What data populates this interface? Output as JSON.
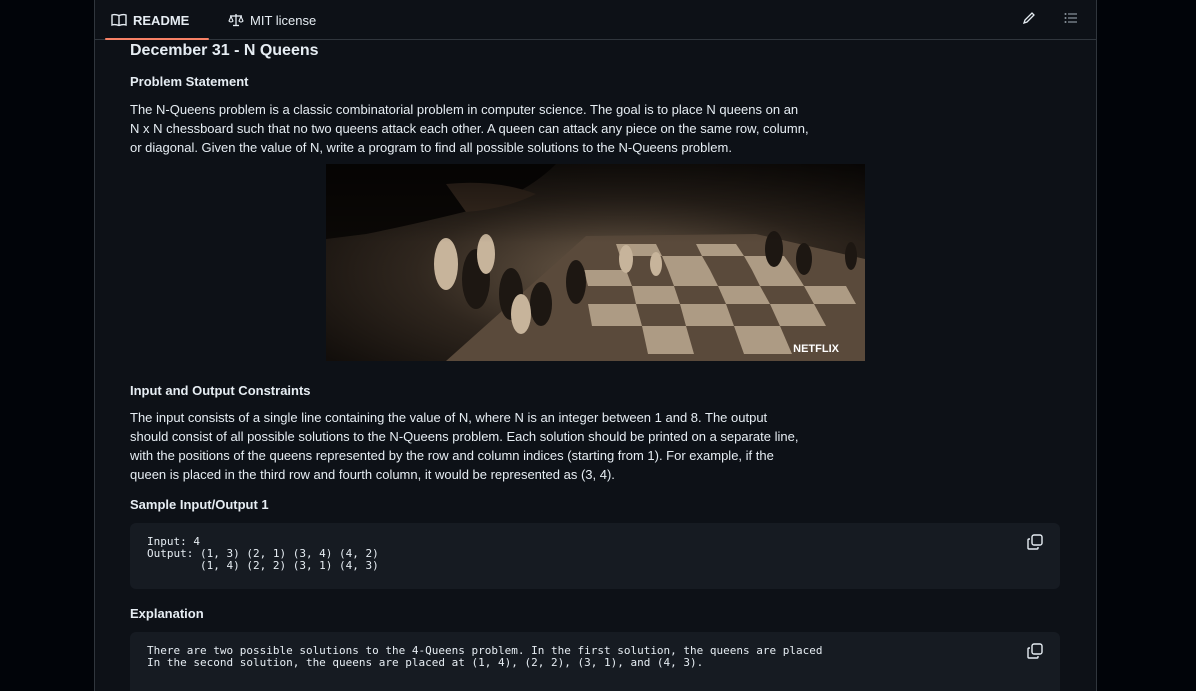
{
  "tabs": [
    {
      "label": "README",
      "icon": "book-icon",
      "active": true
    },
    {
      "label": "MIT license",
      "icon": "law-icon",
      "active": false
    }
  ],
  "tools": [
    "pencil-icon",
    "list-icon"
  ],
  "title": "December 31 - N Queens",
  "sections": {
    "problem": {
      "heading": "Problem Statement",
      "lines": [
        "The N-Queens problem is a classic combinatorial problem in computer science. The goal is to place N queens on an",
        "N x N chessboard such that no two queens attack each other. A queen can attack any piece on the same row, column,",
        "or diagonal. Given the value of N, write a program to find all possible solutions to the N-Queens problem."
      ]
    },
    "image": {
      "watermark": "NETFLIX"
    },
    "constraints": {
      "heading": "Input and Output Constraints",
      "lines": [
        "The input consists of a single line containing the value of N, where N is an integer between 1 and 8. The output",
        "should consist of all possible solutions to the N-Queens problem. Each solution should be printed on a separate line,",
        "with the positions of the queens represented by the row and column indices (starting from 1). For example, if the",
        "queen is placed in the third row and fourth column, it would be represented as (3, 4)."
      ]
    },
    "sample": {
      "heading": "Sample Input/Output 1",
      "code": "Input: 4\nOutput: (1, 3) (2, 1) (3, 4) (4, 2)\n        (1, 4) (2, 2) (3, 1) (4, 3)"
    },
    "explanation": {
      "heading": "Explanation",
      "code": "There are two possible solutions to the 4-Queens problem. In the first solution, the queens are placed\nIn the second solution, the queens are placed at (1, 4), (2, 2), (3, 1), and (4, 3)."
    }
  },
  "colors": {
    "page_bg": "#010409",
    "panel_bg": "#0d1117",
    "code_bg": "#161b22",
    "border": "#30363d",
    "text": "#e6edf3",
    "accent": "#f78166"
  }
}
